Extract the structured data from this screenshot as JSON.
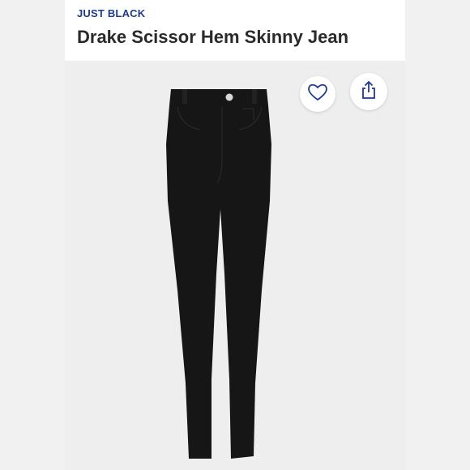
{
  "product": {
    "brand": "JUST BLACK",
    "title": "Drake Scissor Hem Skinny Jean"
  },
  "icons": {
    "favorite": "heart-icon",
    "share": "share-icon"
  },
  "colors": {
    "brand_text": "#1d3c8f",
    "title_text": "#2a2a2a",
    "jeans": "#161616",
    "background": "#eeeeee",
    "accent_icon": "#1f3a8a"
  }
}
